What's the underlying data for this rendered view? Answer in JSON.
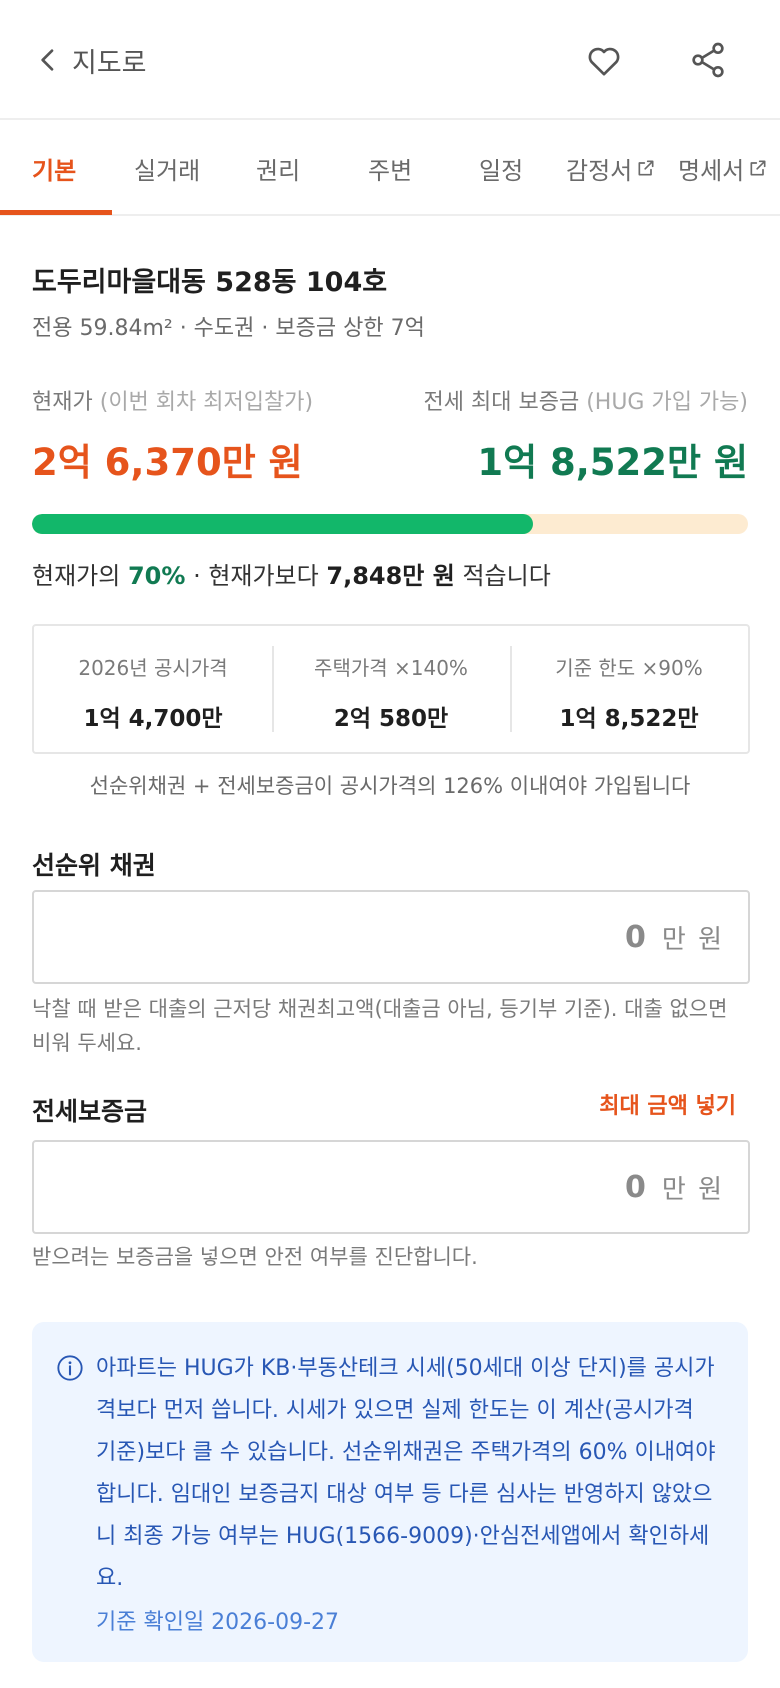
{
  "header": {
    "back_label": "지도로"
  },
  "tabs": [
    {
      "label": "기본"
    },
    {
      "label": "실거래"
    },
    {
      "label": "권리"
    },
    {
      "label": "주변"
    },
    {
      "label": "일정"
    },
    {
      "label": "감정서"
    },
    {
      "label": "명세서"
    }
  ],
  "property": {
    "title": "도두리마을대동 528동 104호",
    "subtitle": "전용 59.84m² · 수도권 · 보증금 상한 7억"
  },
  "prices": {
    "current_label": "현재가",
    "current_note": "(이번 회차 최저입찰가)",
    "current_value": "2억 6,370만 원",
    "max_label": "전세 최대 보증금",
    "max_note": "(HUG 가입 가능)",
    "max_value": "1억 8,522만 원",
    "ratio_fraction": 0.7
  },
  "summary": {
    "prefix": "현재가의",
    "percent": "70%",
    "middle": "· 현재가보다",
    "diff": "7,848만 원",
    "suffix": "적습니다"
  },
  "stats": [
    {
      "label": "2026년 공시가격",
      "value": "1억 4,700만"
    },
    {
      "label": "주택가격 ×140%",
      "value": "2억 580만"
    },
    {
      "label": "기준 한도 ×90%",
      "value": "1억 8,522만"
    }
  ],
  "note": "선순위채권 + 전세보증금이 공시가격의 126% 이내여야 가입됩니다",
  "senior": {
    "label": "선순위 채권",
    "value": "0",
    "unit": "만 원",
    "hint": "낙찰 때 받은 대출의 근저당 채권최고액(대출금 아님, 등기부 기준). 대출 없으면 비워 두세요."
  },
  "deposit": {
    "label": "전세보증금",
    "max_button": "최대 금액 넣기",
    "value": "0",
    "unit": "만 원",
    "hint": "받으려는 보증금을 넣으면 안전 여부를 진단합니다."
  },
  "info": {
    "text": "아파트는 HUG가 KB·부동산테크 시세(50세대 이상 단지)를 공시가격보다 먼저 씁니다. 시세가 있으면 실제 한도는 이 계산(공시가격 기준)보다 클 수 있습니다. 선순위채권은 주택가격의 60% 이내여야 합니다. 임대인 보증금지 대상 여부 등 다른 심사는 반영하지 않았으니 최종 가능 여부는 HUG(1566-9009)·안심전세앱에서 확인하세요.",
    "date": "기준 확인일 2026-09-27"
  },
  "colors": {
    "accent": "#e6541c",
    "green": "#117a52",
    "bar_fill": "#12b76a",
    "bar_track": "#fdebd1",
    "info_bg": "#eef5ff",
    "info_text": "#2857b4"
  },
  "icons": {
    "back": "chevron-left-icon",
    "favorite": "heart-icon",
    "share": "share-icon",
    "external": "external-link-icon",
    "info": "info-icon"
  }
}
